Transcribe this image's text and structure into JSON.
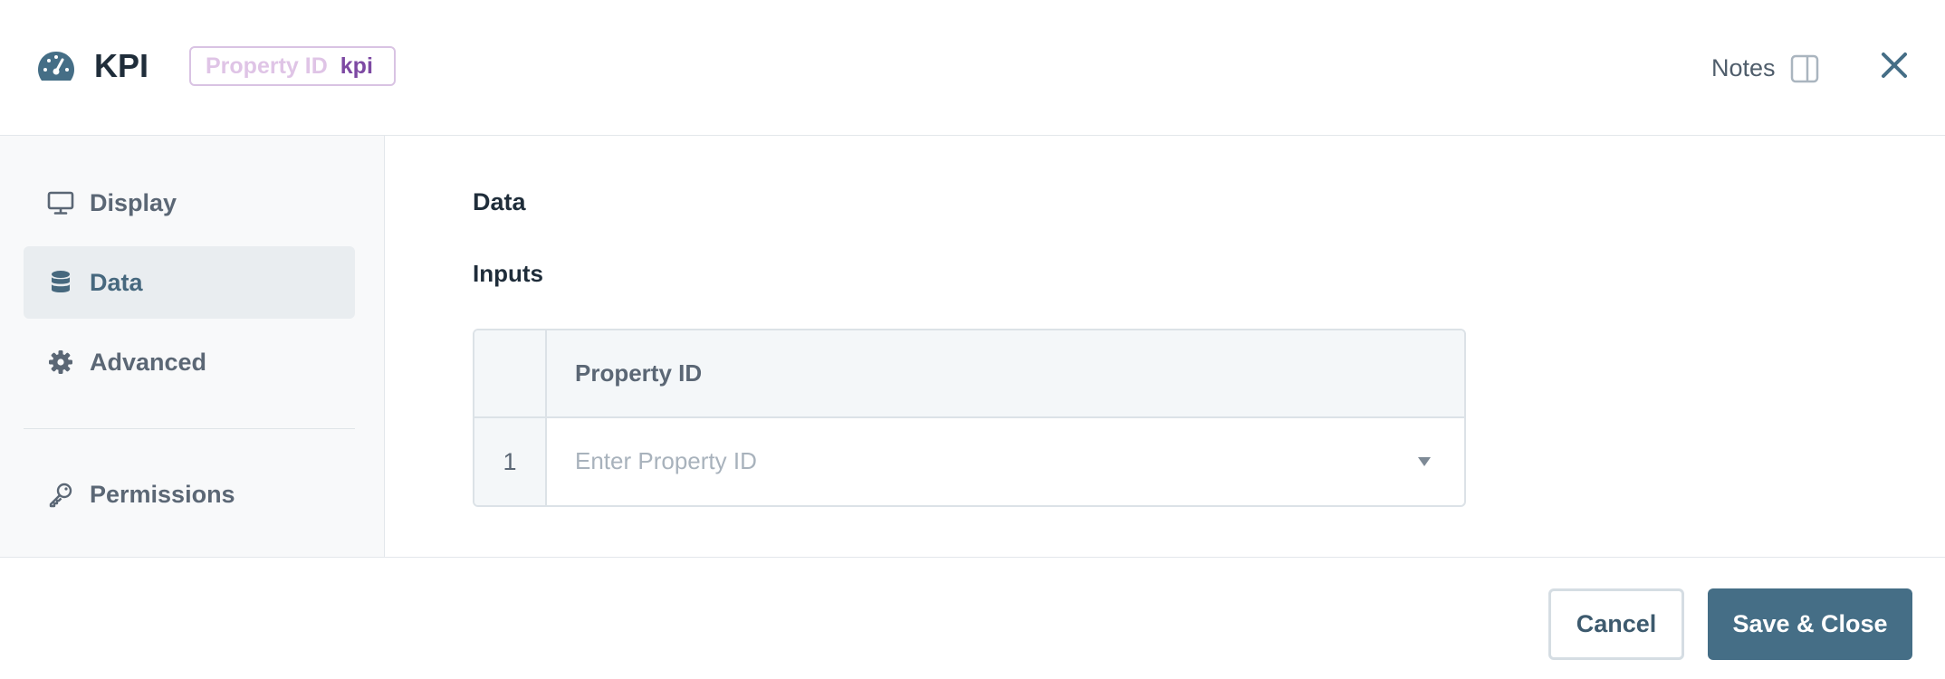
{
  "header": {
    "title": "KPI",
    "title_icon": "gauge-icon",
    "badge": {
      "label": "Property ID",
      "value": "kpi"
    },
    "notes_label": "Notes",
    "notes_icon": "side-panel-icon",
    "close_icon": "close-icon"
  },
  "sidebar": {
    "items": [
      {
        "label": "Display",
        "icon": "monitor-icon",
        "active": false
      },
      {
        "label": "Data",
        "icon": "database-icon",
        "active": true
      },
      {
        "label": "Advanced",
        "icon": "gear-icon",
        "active": false
      },
      {
        "label": "Permissions",
        "icon": "key-icon",
        "active": false
      }
    ]
  },
  "main": {
    "section_title": "Data",
    "inputs_title": "Inputs",
    "table": {
      "header": "Property ID",
      "rows": [
        {
          "index": "1",
          "placeholder": "Enter Property ID"
        }
      ]
    }
  },
  "footer": {
    "cancel_label": "Cancel",
    "save_label": "Save & Close"
  },
  "colors": {
    "accent": "#456e86",
    "badge_border": "#d9c3e3",
    "badge_value": "#7d49a3",
    "active_nav_bg": "#e9edf0"
  }
}
